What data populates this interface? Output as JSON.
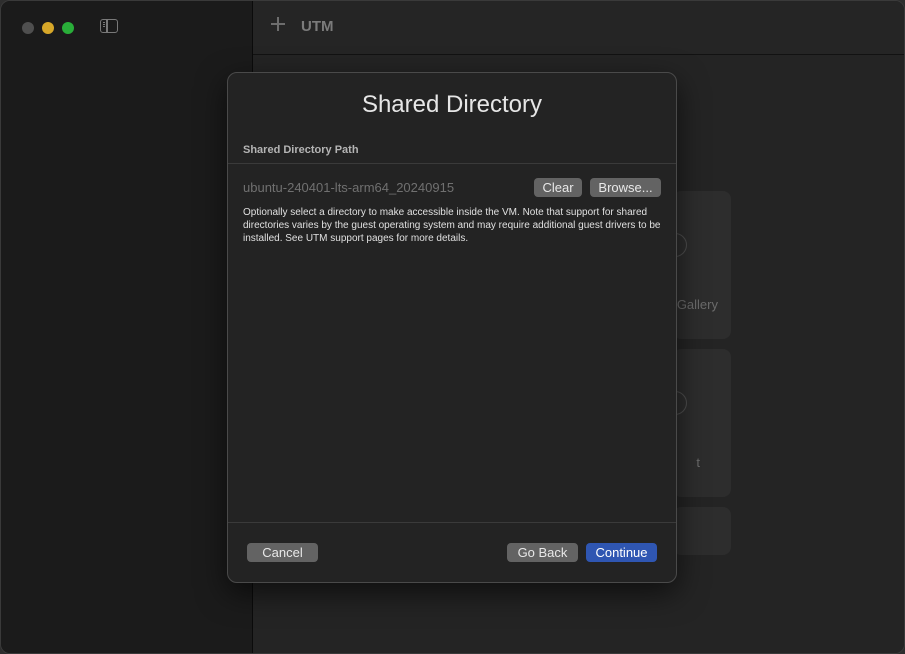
{
  "window": {
    "title": "UTM"
  },
  "toolbar": {
    "title": "UTM",
    "add_icon": "plus-icon",
    "sidebar_icon": "sidebar-toggle-icon"
  },
  "background_cards": {
    "card1_text": "Gallery",
    "card2_text": "t"
  },
  "dialog": {
    "title": "Shared Directory",
    "section_header": "Shared Directory Path",
    "path_value": "ubuntu-240401-lts-arm64_20240915",
    "clear_label": "Clear",
    "browse_label": "Browse...",
    "help_text": "Optionally select a directory to make accessible inside the VM. Note that support for shared directories varies by the guest operating system and may require additional guest drivers to be installed. See UTM support pages for more details.",
    "cancel_label": "Cancel",
    "go_back_label": "Go Back",
    "continue_label": "Continue"
  },
  "colors": {
    "accent": "#2f56b2",
    "traffic_minimize": "#f5bf2f",
    "traffic_maximize": "#2fc741"
  }
}
